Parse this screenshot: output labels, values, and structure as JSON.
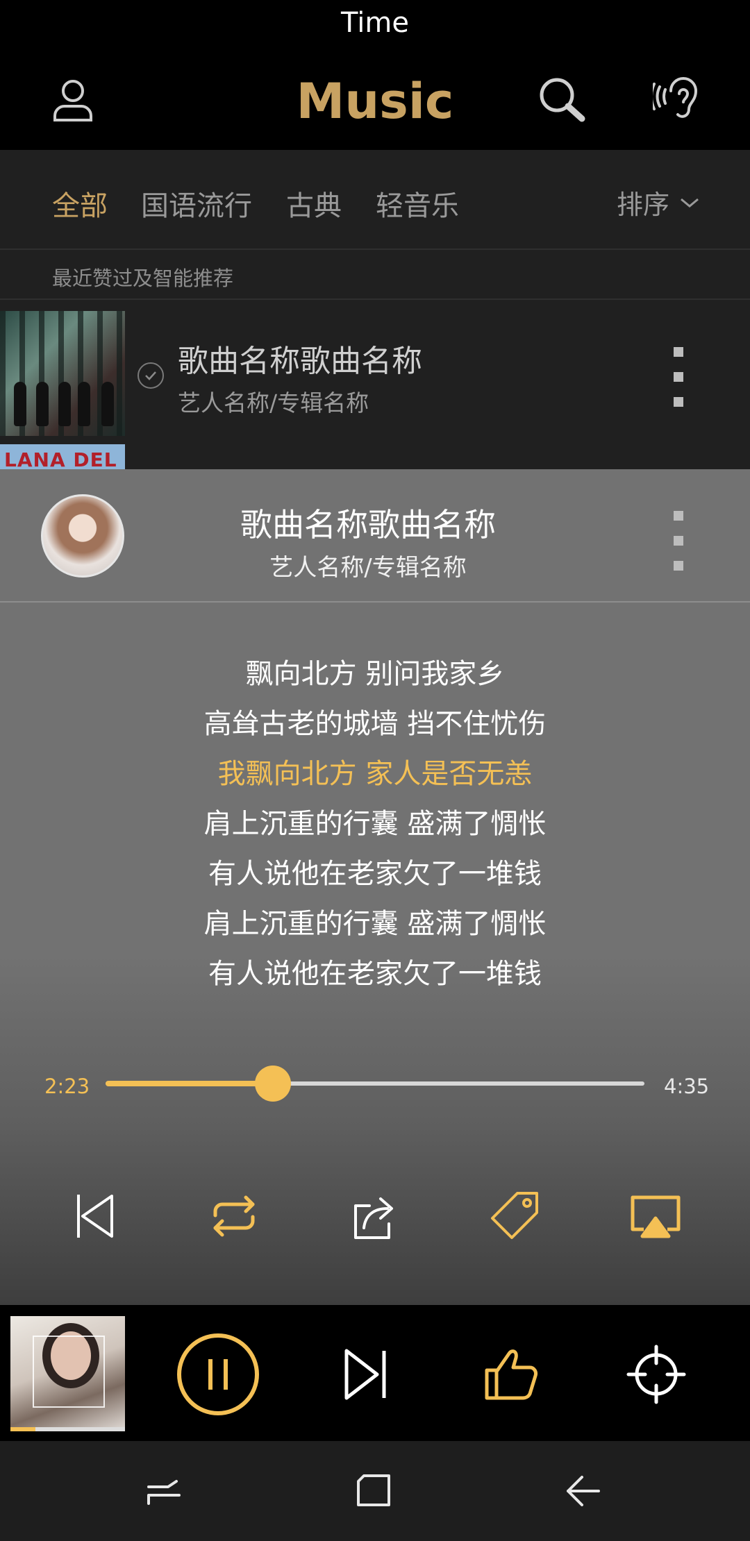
{
  "status_bar": {
    "time": "Time"
  },
  "header": {
    "title": "Music",
    "icons": [
      "user-icon",
      "search-icon",
      "hearing-icon"
    ]
  },
  "tabs": {
    "items": [
      {
        "label": "全部",
        "active": true
      },
      {
        "label": "国语流行",
        "active": false
      },
      {
        "label": "古典",
        "active": false
      },
      {
        "label": "轻音乐",
        "active": false
      }
    ],
    "sort_label": "排序"
  },
  "recent_label": "最近赞过及智能推荐",
  "song_list": [
    {
      "title": "歌曲名称歌曲名称",
      "subtitle": "艺人名称/专辑名称"
    },
    {
      "cover_text": "LANA DEL REY"
    }
  ],
  "now_playing": {
    "title": "歌曲名称歌曲名称",
    "subtitle": "艺人名称/专辑名称",
    "lyrics": [
      "飘向北方 别问我家乡",
      "高耸古老的城墙 挡不住忧伤",
      "我飘向北方 家人是否无恙",
      "肩上沉重的行囊 盛满了惆怅",
      "有人说他在老家欠了一堆钱",
      "肩上沉重的行囊 盛满了惆怅",
      "有人说他在老家欠了一堆钱"
    ],
    "current_lyric_index": 2,
    "elapsed": "2:23",
    "duration": "4:35",
    "progress": 0.31,
    "controls": [
      "previous-icon",
      "repeat-icon",
      "share-icon",
      "tag-icon",
      "airplay-icon"
    ]
  },
  "mini_player": {
    "progress": 0.22,
    "controls": [
      "pause-icon",
      "next-icon",
      "like-icon",
      "locate-icon"
    ]
  },
  "nav_bar": [
    "recents-icon",
    "home-icon",
    "back-icon"
  ],
  "colors": {
    "accent": "#c8a262",
    "highlight": "#f4c055",
    "panel": "#727272",
    "list_bg": "#202020"
  }
}
